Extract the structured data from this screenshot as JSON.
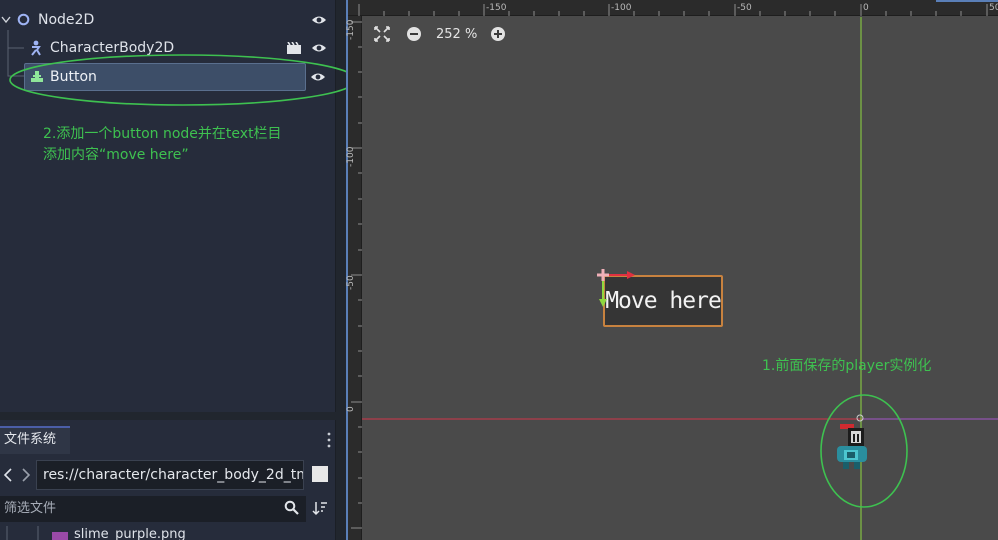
{
  "scene_tree": {
    "nodes": [
      {
        "label": "Node2D"
      },
      {
        "label": "CharacterBody2D"
      },
      {
        "label": "Button"
      }
    ]
  },
  "annotations": {
    "note_button_line1": "2.添加一个button node并在text栏目",
    "note_button_line2": "添加内容“move here”",
    "note_player": "1.前面保存的player实例化"
  },
  "filesystem": {
    "tab_label": "文件系统",
    "path": "res://character/character_body_2d_tm",
    "filter_placeholder": "筛选文件",
    "partial_item": "slime_purple.png"
  },
  "viewport": {
    "zoom_label": "252 %",
    "ruler_top": [
      "-150",
      "-100",
      "-50",
      "0",
      "50"
    ],
    "ruler_left": [
      "-150",
      "-100",
      "-50",
      "0"
    ],
    "button_text": "Move here"
  },
  "colors": {
    "accent_green": "#3ec150",
    "selection": "#3d4e68",
    "button_border": "#c8823f",
    "axis_x": "#d0354a",
    "axis_y": "#8fd840",
    "viewport_bg": "#4a4a4a"
  }
}
